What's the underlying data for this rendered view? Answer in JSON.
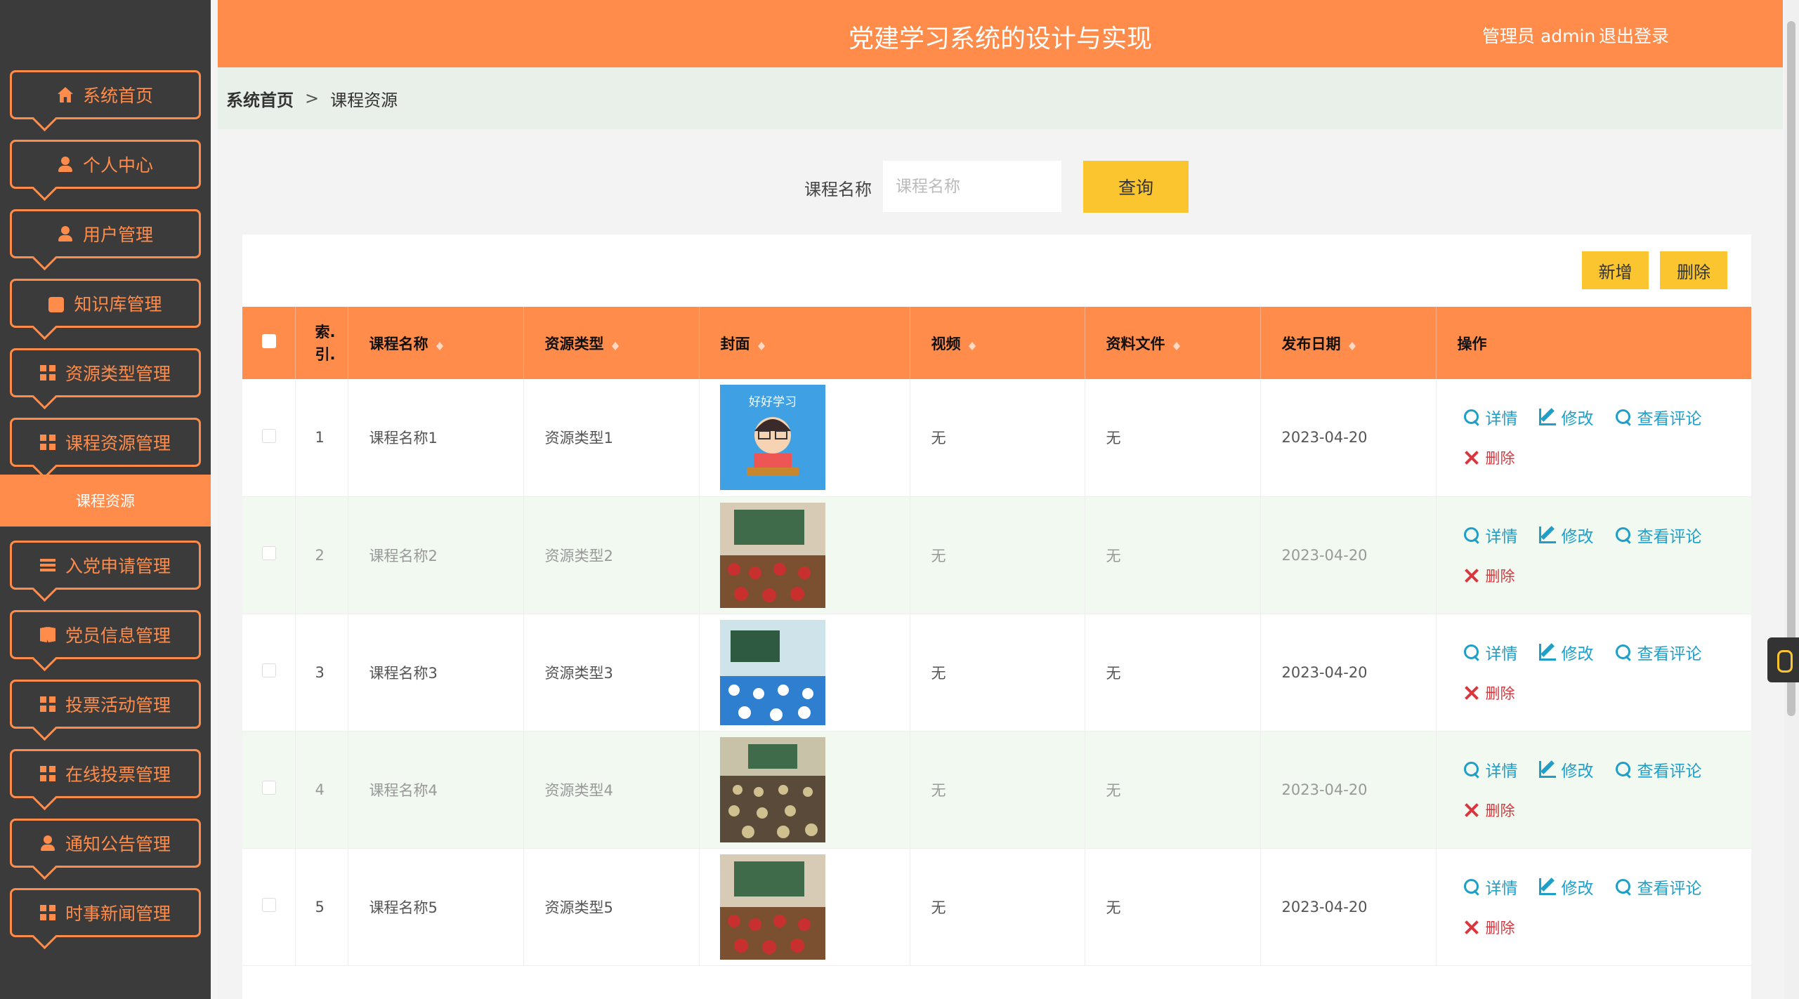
{
  "header": {
    "title": "党建学习系统的设计与实现",
    "admin": "管理员 admin",
    "logout": "退出登录"
  },
  "sidebar": {
    "items": [
      {
        "label": "系统首页",
        "icon": "home-icon"
      },
      {
        "label": "个人中心",
        "icon": "user-icon"
      },
      {
        "label": "用户管理",
        "icon": "user-icon"
      },
      {
        "label": "知识库管理",
        "icon": "knowledge-icon"
      },
      {
        "label": "资源类型管理",
        "icon": "grid-icon"
      },
      {
        "label": "课程资源管理",
        "icon": "grid-icon"
      },
      {
        "label": "入党申请管理",
        "icon": "list-icon"
      },
      {
        "label": "党员信息管理",
        "icon": "book-icon"
      },
      {
        "label": "投票活动管理",
        "icon": "grid-icon"
      },
      {
        "label": "在线投票管理",
        "icon": "grid-icon"
      },
      {
        "label": "通知公告管理",
        "icon": "user-icon"
      },
      {
        "label": "时事新闻管理",
        "icon": "grid-icon"
      }
    ],
    "active_sub": "课程资源"
  },
  "breadcrumb": {
    "home": "系统首页",
    "sep": ">",
    "current": "课程资源"
  },
  "search": {
    "label": "课程名称",
    "placeholder": "课程名称",
    "button": "查询"
  },
  "toolbar": {
    "add": "新增",
    "delete": "删除"
  },
  "table": {
    "headers": [
      "索引",
      "课程名称",
      "资源类型",
      "封面",
      "视频",
      "资料文件",
      "发布日期",
      "操作"
    ],
    "index_header": "索.\n引.",
    "rows": [
      {
        "index": "1",
        "name": "课程名称1",
        "type": "资源类型1",
        "video": "无",
        "file": "无",
        "date": "2023-04-20"
      },
      {
        "index": "2",
        "name": "课程名称2",
        "type": "资源类型2",
        "video": "无",
        "file": "无",
        "date": "2023-04-20"
      },
      {
        "index": "3",
        "name": "课程名称3",
        "type": "资源类型3",
        "video": "无",
        "file": "无",
        "date": "2023-04-20"
      },
      {
        "index": "4",
        "name": "课程名称4",
        "type": "资源类型4",
        "video": "无",
        "file": "无",
        "date": "2023-04-20"
      },
      {
        "index": "5",
        "name": "课程名称5",
        "type": "资源类型5",
        "video": "无",
        "file": "无",
        "date": "2023-04-20"
      }
    ],
    "ops": {
      "detail": "详情",
      "edit": "修改",
      "comments": "查看评论",
      "delete": "删除"
    },
    "cover_texts": [
      "好好学习"
    ]
  },
  "colors": {
    "accent": "#ff8c4b",
    "sidebar_bg": "#3b3b3b",
    "button_yellow": "#fbc52f",
    "link_blue": "#1f9fc8",
    "danger_red": "#d9363e"
  }
}
